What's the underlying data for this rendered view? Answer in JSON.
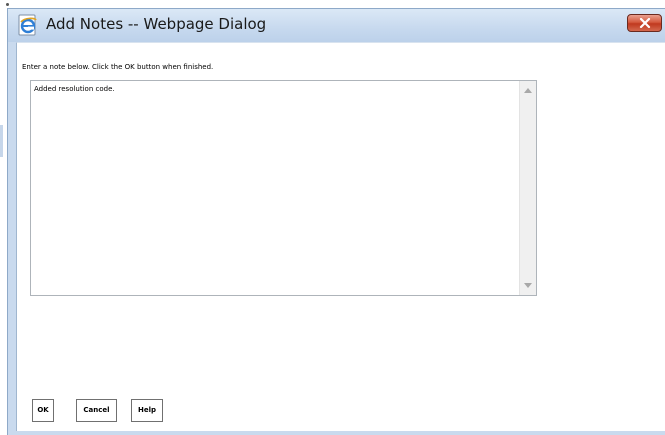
{
  "window": {
    "title": "Add Notes -- Webpage Dialog",
    "app_icon": "internet-explorer-icon",
    "close_icon": "close-icon",
    "accent_color": "#c9daee",
    "close_color": "#c0391f"
  },
  "dialog": {
    "instruction": "Enter a note below. Click the OK button when finished.",
    "note_value": "Added resolution code."
  },
  "buttons": {
    "ok_label": "OK",
    "cancel_label": "Cancel",
    "help_label": "Help"
  }
}
